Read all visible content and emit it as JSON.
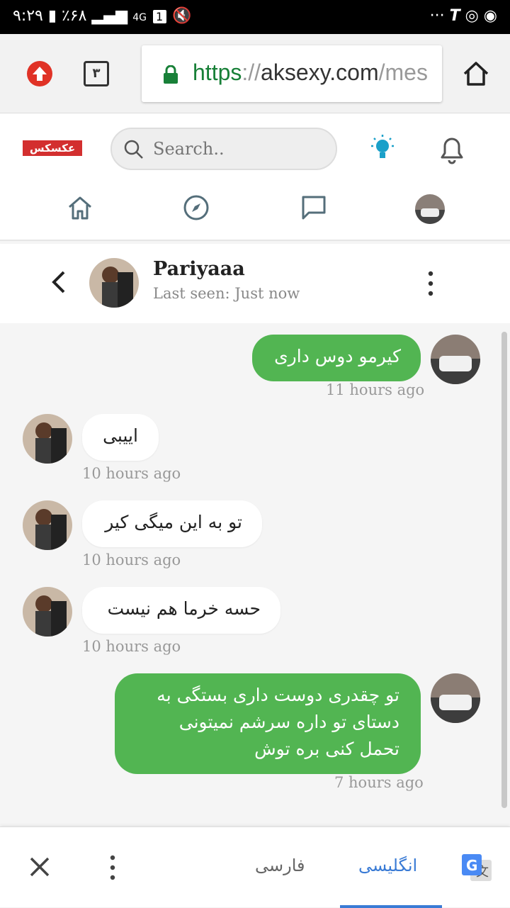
{
  "status_bar": {
    "time": "۹:۲۹",
    "battery": "٪۶۸",
    "network": "4G",
    "sim": "1"
  },
  "browser": {
    "tab_count": "۳",
    "url_scheme": "https",
    "url_sep": "://",
    "url_host": "aksexy.com",
    "url_path": "/mes"
  },
  "site": {
    "logo_text": "عکسکس",
    "search_placeholder": "Search.."
  },
  "chat": {
    "contact_name": "Pariyaaa",
    "last_seen": "Last seen: Just now",
    "messages": [
      {
        "direction": "out",
        "text": "کیرمو دوس داری",
        "time": "11 hours ago"
      },
      {
        "direction": "in",
        "text": "اییبی",
        "time": "10 hours ago"
      },
      {
        "direction": "in",
        "text": "تو به این میگی کیر",
        "time": "10 hours ago"
      },
      {
        "direction": "in",
        "text": "حسه خرما هم نیست",
        "time": "10 hours ago"
      },
      {
        "direction": "out",
        "text": "تو چقدری دوست داری بستگی به دستای تو داره سرشم نمیتونی تحمل کنی بره توش",
        "time": "7 hours ago"
      }
    ]
  },
  "translate_bar": {
    "source_lang": "فارسی",
    "target_lang": "انگلیسی",
    "accent_color": "#3a7bd5"
  },
  "colors": {
    "outgoing_bubble": "#52b552",
    "incoming_bubble": "#ffffff",
    "lock_green": "#188038"
  }
}
